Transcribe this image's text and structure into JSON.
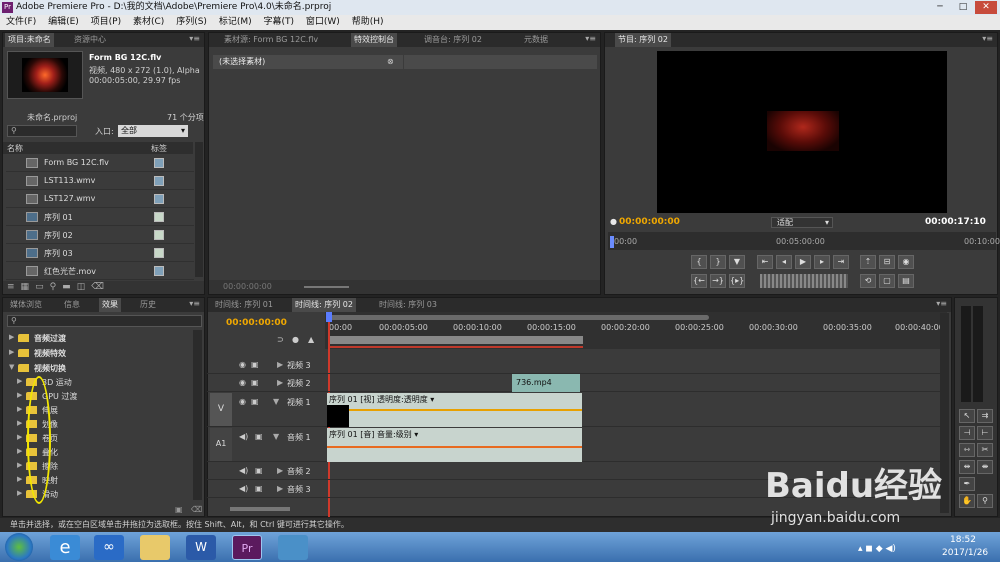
{
  "window": {
    "title": "Adobe Premiere Pro - D:\\我的文档\\Adobe\\Premiere Pro\\4.0\\未命名.prproj"
  },
  "menu": [
    "文件(F)",
    "编辑(E)",
    "项目(P)",
    "素材(C)",
    "序列(S)",
    "标记(M)",
    "字幕(T)",
    "窗口(W)",
    "帮助(H)"
  ],
  "project": {
    "tabs": [
      "项目:未命名",
      "资源中心"
    ],
    "clip_name": "Form BG 12C.flv",
    "clip_info1": "视频, 480 x 272 (1.0), Alpha",
    "clip_info2": "00:00:05:00, 29.97 fps",
    "file": "未命名.prproj",
    "count": "71 个分项",
    "in_label": "入口:",
    "in_value": "全部",
    "col_name": "名称",
    "col_label": "标签",
    "items": [
      "Form BG 12C.flv",
      "LST113.wmv",
      "LST127.wmv",
      "序列 01",
      "序列 02",
      "序列 03",
      "红色光芒.mov"
    ]
  },
  "source": {
    "tabs": [
      "素材源: Form BG 12C.flv",
      "特效控制台",
      "调音台: 序列 02",
      "元数据"
    ],
    "no_clip": "(未选择素材)",
    "timecode": "00:00:00:00"
  },
  "program": {
    "tab": "节目: 序列 02",
    "timecode_left": "00:00:00:00",
    "fit": "适配",
    "timecode_right": "00:00:17:10",
    "ruler": [
      "00:00",
      "00:05:00:00",
      "00:10:00"
    ]
  },
  "effects": {
    "tabs": [
      "媒体浏览",
      "信息",
      "效果",
      "历史"
    ],
    "folders": [
      "音频过渡",
      "视频特效",
      "视频切换"
    ],
    "subfolders": [
      "3D 运动",
      "GPU 过渡",
      "伸展",
      "划像",
      "卷页",
      "叠化",
      "擦除",
      "映射",
      "滑动"
    ]
  },
  "timeline": {
    "tabs": [
      "时间线: 序列 01",
      "时间线: 序列 02",
      "时间线: 序列 03"
    ],
    "timecode": "00:00:00:00",
    "ruler": [
      "00:00",
      "00:00:05:00",
      "00:00:10:00",
      "00:00:15:00",
      "00:00:20:00",
      "00:00:25:00",
      "00:00:30:00",
      "00:00:35:00",
      "00:00:40:00"
    ],
    "tracks": [
      "视频 3",
      "视频 2",
      "视频 1",
      "音频 1",
      "音频 2",
      "音频 3"
    ],
    "v_label": "V",
    "a_label": "A1",
    "clip_736": "736.mp4",
    "clip_v1": "序列 01 [视] 透明度:透明度 ▾",
    "clip_a1": "序列 01 [音] 音量:级别 ▾"
  },
  "status": {
    "text": "单击并选择，或在空白区域单击并拖拉为选取框。按住 Shift、Alt，和 Ctrl 键可进行其它操作。"
  },
  "taskbar": {
    "time": "18:52",
    "date": "2017/1/26"
  },
  "watermark": {
    "brand": "Baidu经验",
    "url": "jingyan.baidu.com"
  }
}
